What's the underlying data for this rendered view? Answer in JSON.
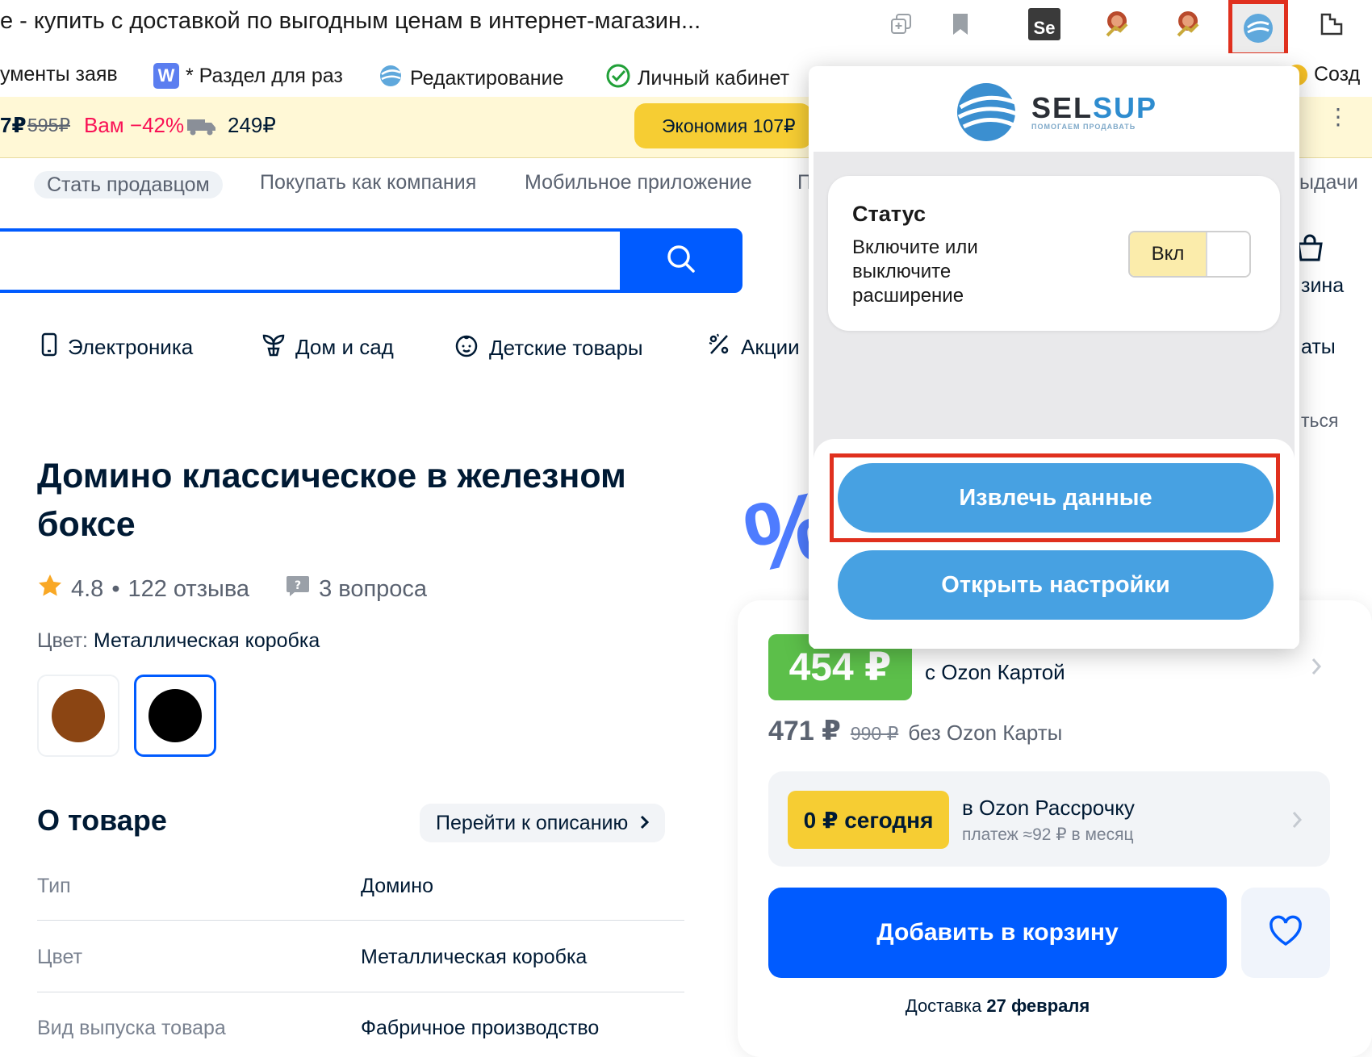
{
  "browser": {
    "tab_title": "е - купить с доставкой по выгодным ценам в интернет-магазин...",
    "ext_se": "Se",
    "bookmarks": [
      {
        "label": "ументы заяв",
        "icon": ""
      },
      {
        "label": "* Раздел для раз",
        "icon": "W"
      },
      {
        "label": "Редактирование",
        "icon": "globe"
      },
      {
        "label": "Личный кабинет",
        "icon": "check"
      },
      {
        "label": "Созд",
        "icon": "circle"
      }
    ]
  },
  "promo": {
    "price_old_prefix": "7₽",
    "price_old": "595₽",
    "discount": "Вам −42%",
    "price_new": "249₽",
    "button": "Экономия 107₽"
  },
  "topnav": {
    "become_seller": "Стать продавцом",
    "buy_as_company": "Покупать как компания",
    "mobile_app": "Мобильное приложение",
    "cut_g": "П",
    "pickup_tail": "ыдачи"
  },
  "header_right": {
    "cart_tail": "зина",
    "cats_tail": "аты",
    "login_tail": "ться"
  },
  "categories": [
    {
      "label": "Электроника",
      "icon": "phone-icon"
    },
    {
      "label": "Дом и сад",
      "icon": "plant-icon"
    },
    {
      "label": "Детские товары",
      "icon": "baby-icon"
    },
    {
      "label": "Акции",
      "icon": "percent-icon"
    }
  ],
  "product": {
    "title": "Домино классическое в железном боксе",
    "rating": "4.8",
    "reviews": "122 отзыва",
    "questions": "3 вопроса",
    "color_label": "Цвет:",
    "color_value": "Металлическая коробка",
    "swatches": [
      "#8b4513",
      "#000000"
    ]
  },
  "about": {
    "title": "О товаре",
    "go_desc": "Перейти к описанию",
    "attrs": [
      {
        "k": "Тип",
        "v": "Домино"
      },
      {
        "k": "Цвет",
        "v": "Металлическая коробка"
      },
      {
        "k": "Вид выпуска товара",
        "v": "Фабричное производство"
      }
    ]
  },
  "buybox": {
    "price_card": "454 ₽",
    "with_card": "с Ozon Картой",
    "price": "471 ₽",
    "price_old": "990 ₽",
    "without_card": "без Ozon Карты",
    "zero_today": "0 ₽ сегодня",
    "installment": "в Ozon Рассрочку",
    "installment_sub": "платеж ≈92 ₽ в месяц",
    "add_to_cart": "Добавить в корзину",
    "delivery_prefix": "Доставка ",
    "delivery_date": "27 февраля"
  },
  "popup": {
    "logo_a": "SEL",
    "logo_b": "SUP",
    "logo_sub": "ПОМОГАЕМ ПРОДАВАТЬ",
    "status_title": "Статус",
    "status_desc": "Включите или выключите расширение",
    "toggle_label": "Вкл",
    "extract_button": "Извлечь данные",
    "settings_button": "Открыть настройки"
  },
  "colors": {
    "accent": "#005bff",
    "popup_button": "#47a1e2",
    "highlight": "#e0301e",
    "price_green": "#5cbf4a"
  }
}
